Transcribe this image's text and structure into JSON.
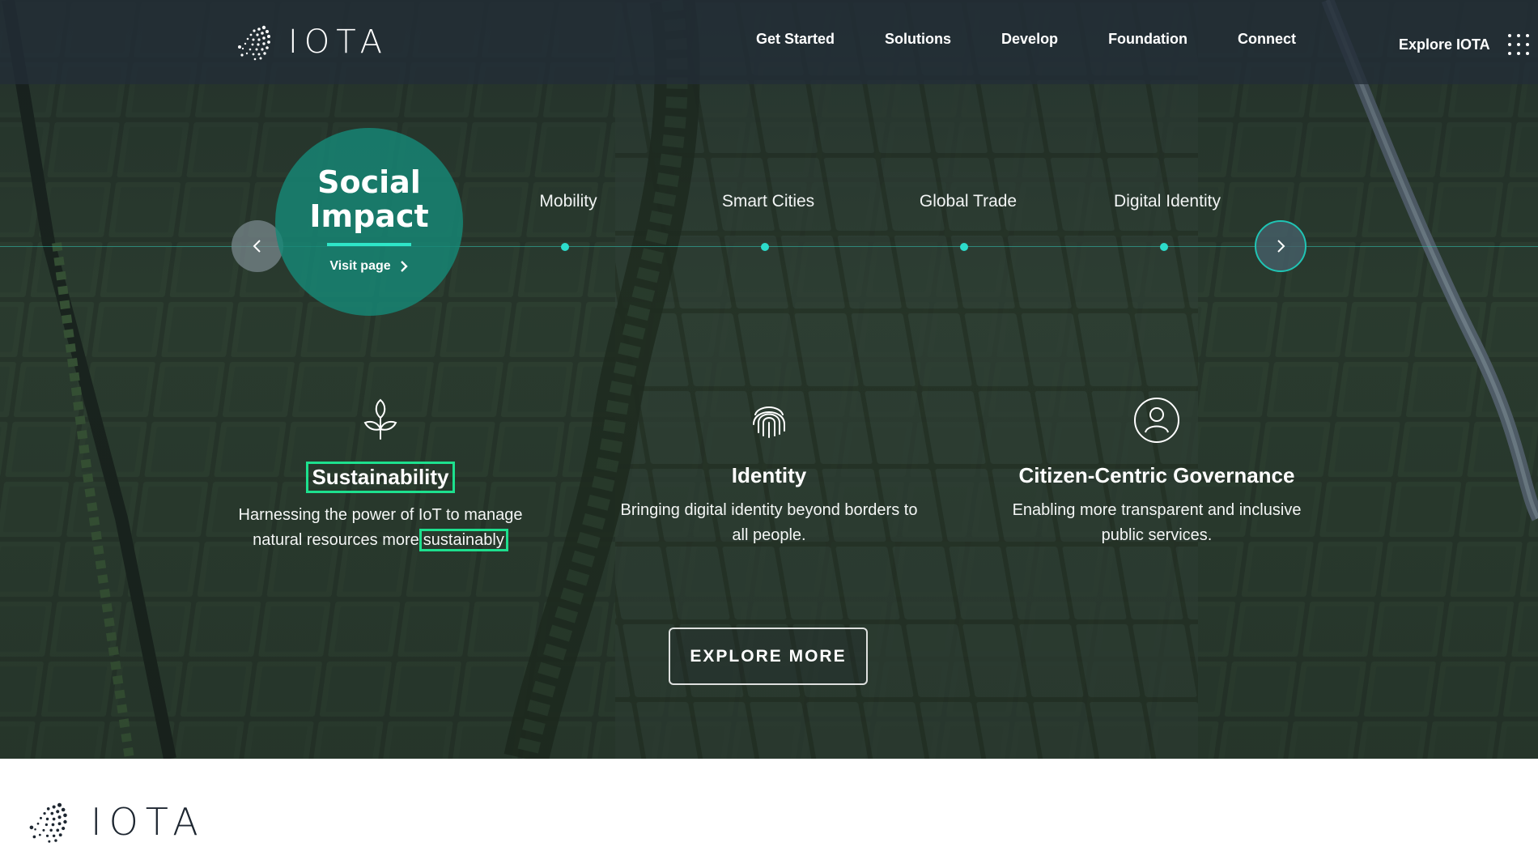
{
  "header": {
    "logo_text": "IOTA",
    "nav": [
      "Get Started",
      "Solutions",
      "Develop",
      "Foundation",
      "Connect"
    ],
    "explore_label": "Explore IOTA"
  },
  "timeline": {
    "active": {
      "title_line1": "Social",
      "title_line2": "Impact",
      "link_label": "Visit page"
    },
    "items": [
      "Mobility",
      "Smart Cities",
      "Global Trade",
      "Digital Identity"
    ]
  },
  "features": [
    {
      "icon": "sprout-icon",
      "title": "Sustainability",
      "desc_line1": "Harnessing the power of IoT to manage",
      "desc_line2_a": "natural resources more",
      "desc_line2_b": "sustainably"
    },
    {
      "icon": "fingerprint-icon",
      "title": "Identity",
      "desc_line1": "Bringing digital identity beyond borders to",
      "desc_line2": "all people."
    },
    {
      "icon": "user-circle-icon",
      "title": "Citizen-Centric Governance",
      "desc_line1": "Enabling more transparent and inclusive",
      "desc_line2": "public services."
    }
  ],
  "cta": {
    "label": "EXPLORE MORE"
  },
  "footer": {
    "logo_text": "IOTA"
  },
  "colors": {
    "accent": "#2ddccb",
    "highlight": "#1de08e",
    "bubble": "#168776",
    "header": "#222d37"
  }
}
